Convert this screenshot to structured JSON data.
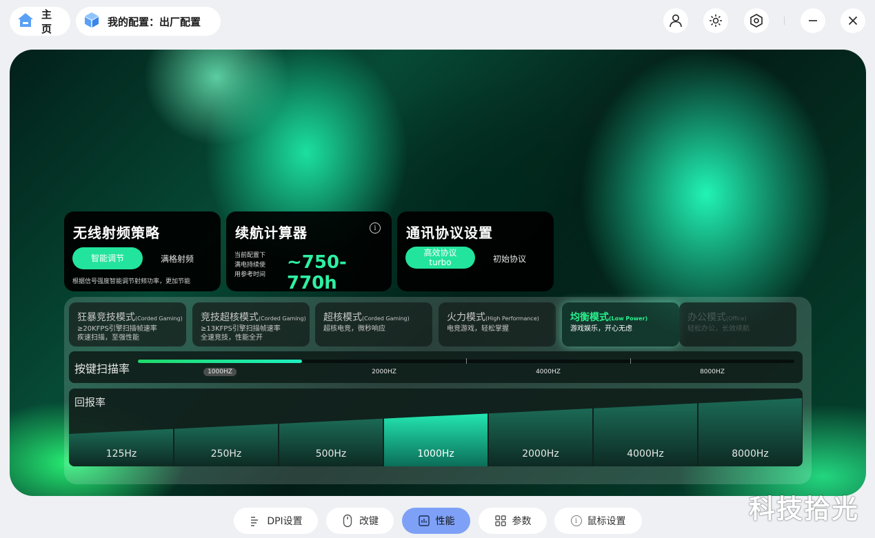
{
  "header": {
    "home_label": "主页",
    "config_label": "我的配置：出厂配置",
    "icons": [
      "user-icon",
      "brightness-icon",
      "settings-hex-icon",
      "minimize-icon",
      "close-icon"
    ]
  },
  "cards": {
    "rf": {
      "title": "无线射频策略",
      "option_active": "智能调节",
      "option_other": "满格射频",
      "note": "根据信号强度智能调节射频功率，更加节能"
    },
    "battery": {
      "title": "续航计算器",
      "caption_lines": [
        "当前配置下",
        "满电持续使",
        "用参考时间"
      ],
      "value": "~750-770h"
    },
    "protocol": {
      "title": "通讯协议设置",
      "option_active_line1": "高效协议",
      "option_active_line2": "turbo",
      "option_other": "初始协议"
    }
  },
  "modes": [
    {
      "name": "狂暴竞技模式",
      "tag": "(Corded Gaming)",
      "desc": "≥20KFPS引擎扫描帧速率\n疾速扫描，至强性能",
      "state": "normal"
    },
    {
      "name": "竞技超核模式",
      "tag": "(Corded Gaming)",
      "desc": "≥13KFPS引擎扫描帧速率\n全速竞技，性能全开",
      "state": "normal"
    },
    {
      "name": "超核模式",
      "tag": "(Corded Gaming)",
      "desc": "超核电竞，微秒响应",
      "state": "normal"
    },
    {
      "name": "火力模式",
      "tag": "(High Performance)",
      "desc": "电竞游戏，轻松掌握",
      "state": "normal"
    },
    {
      "name": "均衡模式",
      "tag": "(Low Power)",
      "desc": "游戏娱乐，开心无虑",
      "state": "active"
    },
    {
      "name": "办公模式",
      "tag": "(Office)",
      "desc": "轻松办公，长效续航",
      "state": "dim"
    }
  ],
  "scan_rate": {
    "label": "按键扫描率",
    "ticks": [
      "1000HZ",
      "2000HZ",
      "4000HZ",
      "8000HZ"
    ],
    "selected": "1000HZ",
    "fill_fraction": 0.25
  },
  "report_rate": {
    "label": "回报率",
    "options": [
      "125Hz",
      "250Hz",
      "500Hz",
      "1000Hz",
      "2000Hz",
      "4000Hz",
      "8000Hz"
    ],
    "selected": "1000Hz"
  },
  "bottom_nav": [
    {
      "label": "DPI设置",
      "icon": "dpi-icon",
      "active": false
    },
    {
      "label": "改键",
      "icon": "mouse-icon",
      "active": false
    },
    {
      "label": "性能",
      "icon": "performance-icon",
      "active": true
    },
    {
      "label": "参数",
      "icon": "grid-icon",
      "active": false
    },
    {
      "label": "鼠标设置",
      "icon": "info-icon",
      "active": false
    }
  ],
  "watermark": "科技拾光",
  "colors": {
    "accent_green": "#22e49c",
    "active_mode_text": "#28f08c",
    "nav_active": "#7ea1f7"
  }
}
